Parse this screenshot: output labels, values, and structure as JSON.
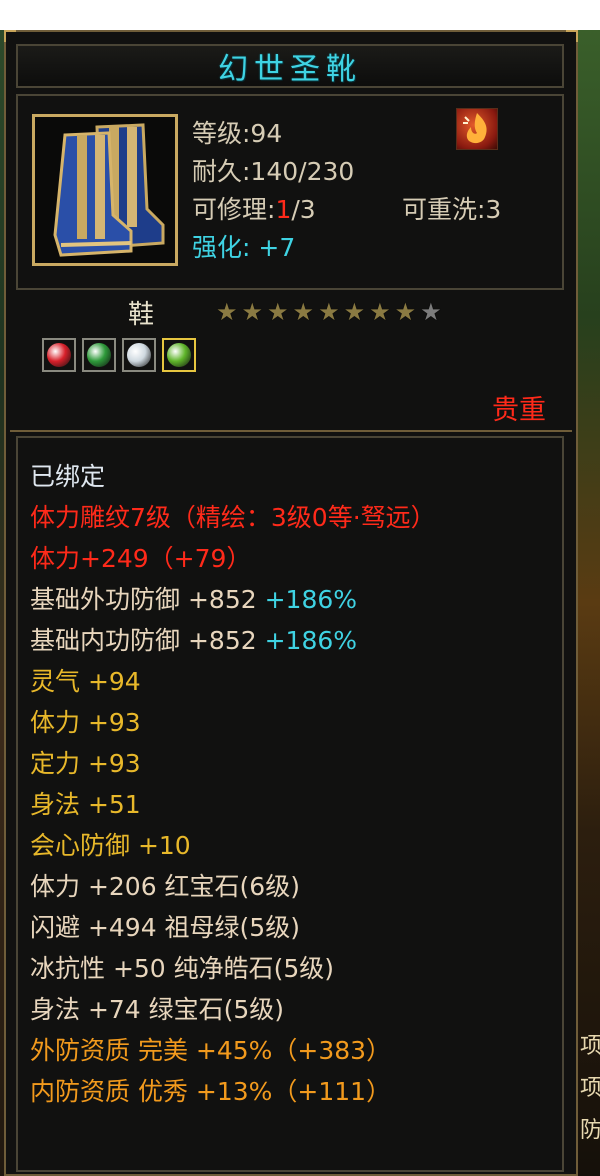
{
  "background": {
    "right_labels": [
      "项",
      "项",
      "防"
    ]
  },
  "tooltip": {
    "title": "幻世圣靴",
    "info": {
      "level": "等级:94",
      "durability": "耐久:140/230",
      "repair_prefix": "可修理:",
      "repair_current": "1",
      "repair_suffix": "/3",
      "rewash": "可重洗:3",
      "enhance": "强化: +7"
    },
    "item_type": "鞋",
    "stars_total": 9,
    "stars_lit": 8,
    "gems": [
      {
        "icon": "red-gem-icon",
        "color": "#d8202a"
      },
      {
        "icon": "green-gem-icon",
        "color": "#2e9a3a"
      },
      {
        "icon": "white-gem-icon",
        "color": "#cfd9e0"
      },
      {
        "icon": "lime-gem-icon",
        "color": "#5fb52a"
      }
    ],
    "rarity": "贵重",
    "stats": {
      "bound": "已绑定",
      "engrave": "体力雕纹7级（精绘：3级0等·驽远）",
      "stamina_main": "体力+249（+79）",
      "outer_def_label": "基础外功防御",
      "outer_def_value": "+852",
      "outer_def_pct": "+186%",
      "inner_def_label": "基础内功防御",
      "inner_def_value": "+852",
      "inner_def_pct": "+186%",
      "lines": [
        "灵气 +94",
        "体力 +93",
        "定力 +93",
        "身法 +51",
        "会心防御 +10"
      ],
      "gem_lines": [
        "体力 +206 红宝石(6级)",
        "闪避 +494 祖母绿(5级)",
        "冰抗性 +50 纯净皓石(5级)",
        "身法 +74 绿宝石(5级)"
      ],
      "aptitude": [
        "外防资质  完美 +45%（+383）",
        "内防资质  优秀 +13%（+111）"
      ]
    }
  }
}
